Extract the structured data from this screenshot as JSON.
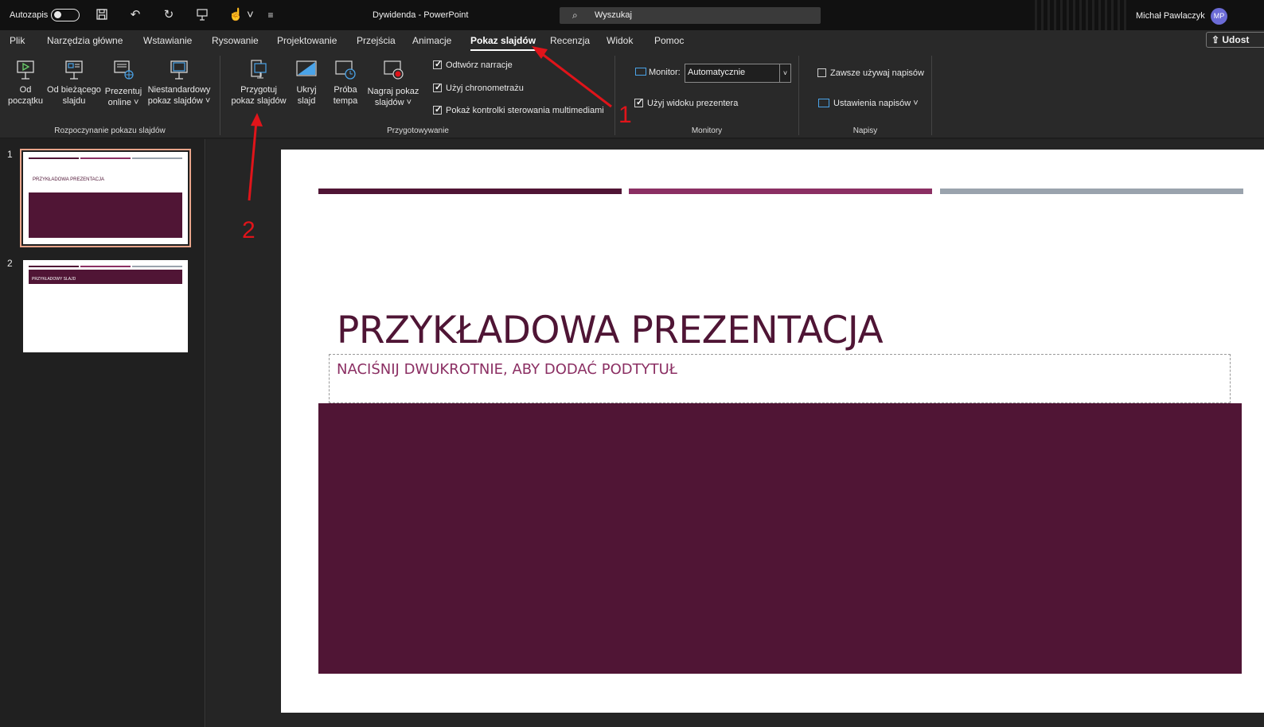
{
  "titlebar": {
    "autosave_label": "Autozapis",
    "doc_title": "Dywidenda  -  PowerPoint",
    "search_placeholder": "Wyszukaj",
    "user_name": "Michał Pawlaczyk",
    "user_initials": "MP"
  },
  "tabs": [
    "Plik",
    "Narzędzia główne",
    "Wstawianie",
    "Rysowanie",
    "Projektowanie",
    "Przejścia",
    "Animacje",
    "Pokaz slajdów",
    "Recenzja",
    "Widok",
    "Pomoc"
  ],
  "active_tab": "Pokaz slajdów",
  "share_label": "Udost",
  "ribbon": {
    "start": {
      "from_beginning": "Od\npoczątku",
      "from_current": "Od bieżącego\nslajdu",
      "present_online": "Prezentuj\nonline ˅",
      "custom_show": "Niestandardowy\npokaz slajdów ˅",
      "group_label": "Rozpoczynanie pokazu slajdów"
    },
    "setup": {
      "setup_show": "Przygotuj\npokaz slajdów",
      "hide_slide": "Ukryj\nslajd",
      "rehearse": "Próba\ntempa",
      "record": "Nagraj pokaz\nslajdów ˅",
      "play_narrations": "Odtwórz narracje",
      "use_timings": "Użyj chronometrażu",
      "show_media_controls": "Pokaż kontrolki sterowania multimediami",
      "group_label": "Przygotowywanie"
    },
    "monitors": {
      "monitor_label": "Monitor:",
      "monitor_value": "Automatycznie",
      "presenter_view": "Użyj widoku prezentera",
      "group_label": "Monitory"
    },
    "captions": {
      "always_subtitles": "Zawsze używaj napisów",
      "subtitle_settings": "Ustawienia napisów ˅",
      "group_label": "Napisy"
    }
  },
  "thumbnails": [
    {
      "number": "1",
      "title": "PRZYKŁADOWA PREZENTACJA"
    },
    {
      "number": "2",
      "title": "PRZYKŁADOWY SLAJD"
    }
  ],
  "slide": {
    "title": "PRZYKŁADOWA PREZENTACJA",
    "subtitle": "NACIŚNIJ DWUKROTNIE, ABY DODAĆ PODTYTUŁ"
  },
  "annotations": [
    "1",
    "2"
  ],
  "colors": {
    "accent_dark": "#501535",
    "accent_mid": "#8b2f63",
    "accent_grey": "#9aa3ad",
    "annotation_red": "#e0141a"
  }
}
